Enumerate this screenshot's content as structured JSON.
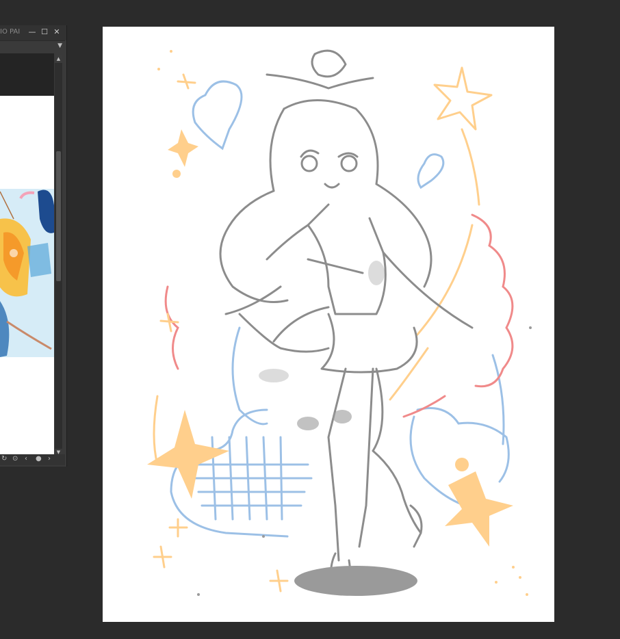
{
  "subview": {
    "title": "IO PAI",
    "window_buttons": {
      "minimize": "—",
      "maximize": "☐",
      "close": "✕"
    },
    "dropdown_icon": "chevron-down-icon",
    "bottom_controls": [
      "↻",
      "⊙",
      "‹",
      "●",
      "›"
    ]
  },
  "colors": {
    "app_background": "#2b2b2b",
    "panel": "#3a3a3a",
    "sketch_gray": "#8c8c8c",
    "pastel_blue": "#9cc0e6",
    "pastel_orange": "#ffcf8c",
    "pastel_red": "#f08a8a"
  }
}
